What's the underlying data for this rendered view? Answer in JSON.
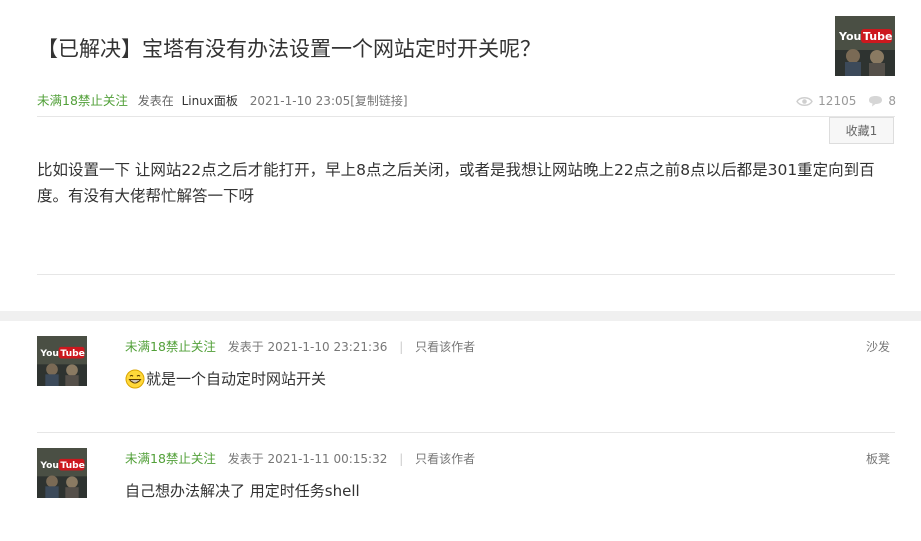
{
  "post": {
    "title": "【已解决】宝塔有没有办法设置一个网站定时开关呢？",
    "author": "未满18禁止关注",
    "posted_in": "发表在",
    "forum": "Linux面板",
    "date": "2021-1-10 23:05",
    "copy_link": "[复制链接]",
    "views": "12105",
    "replies_count": "8",
    "favorite_label": "收藏1",
    "content": "比如设置一下 让网站22点之后才能打开，早上8点之后关闭，或者是我想让网站晚上22点之前8点以后都是301重定向到百度。有没有大佬帮忙解答一下呀",
    "avatar_text": "YouTube"
  },
  "replies": [
    {
      "author": "未满18禁止关注",
      "time": "发表于 2021-1-10 23:21:36",
      "sep": "|",
      "only_author": "只看该作者",
      "floor": "沙发",
      "body": "就是一个自动定时网站开关",
      "avatar_text": "YouTube"
    },
    {
      "author": "未满18禁止关注",
      "time": "发表于 2021-1-11 00:15:32",
      "sep": "|",
      "only_author": "只看该作者",
      "floor": "板凳",
      "body": "自己想办法解决了 用定时任务shell",
      "avatar_text": "YouTube"
    }
  ],
  "icons": {
    "views": "eye-icon",
    "replies": "comment-icon",
    "emoji": "grin-emoji-icon"
  },
  "colors": {
    "author_green": "#52a039",
    "youtube_red": "#cc181e"
  }
}
